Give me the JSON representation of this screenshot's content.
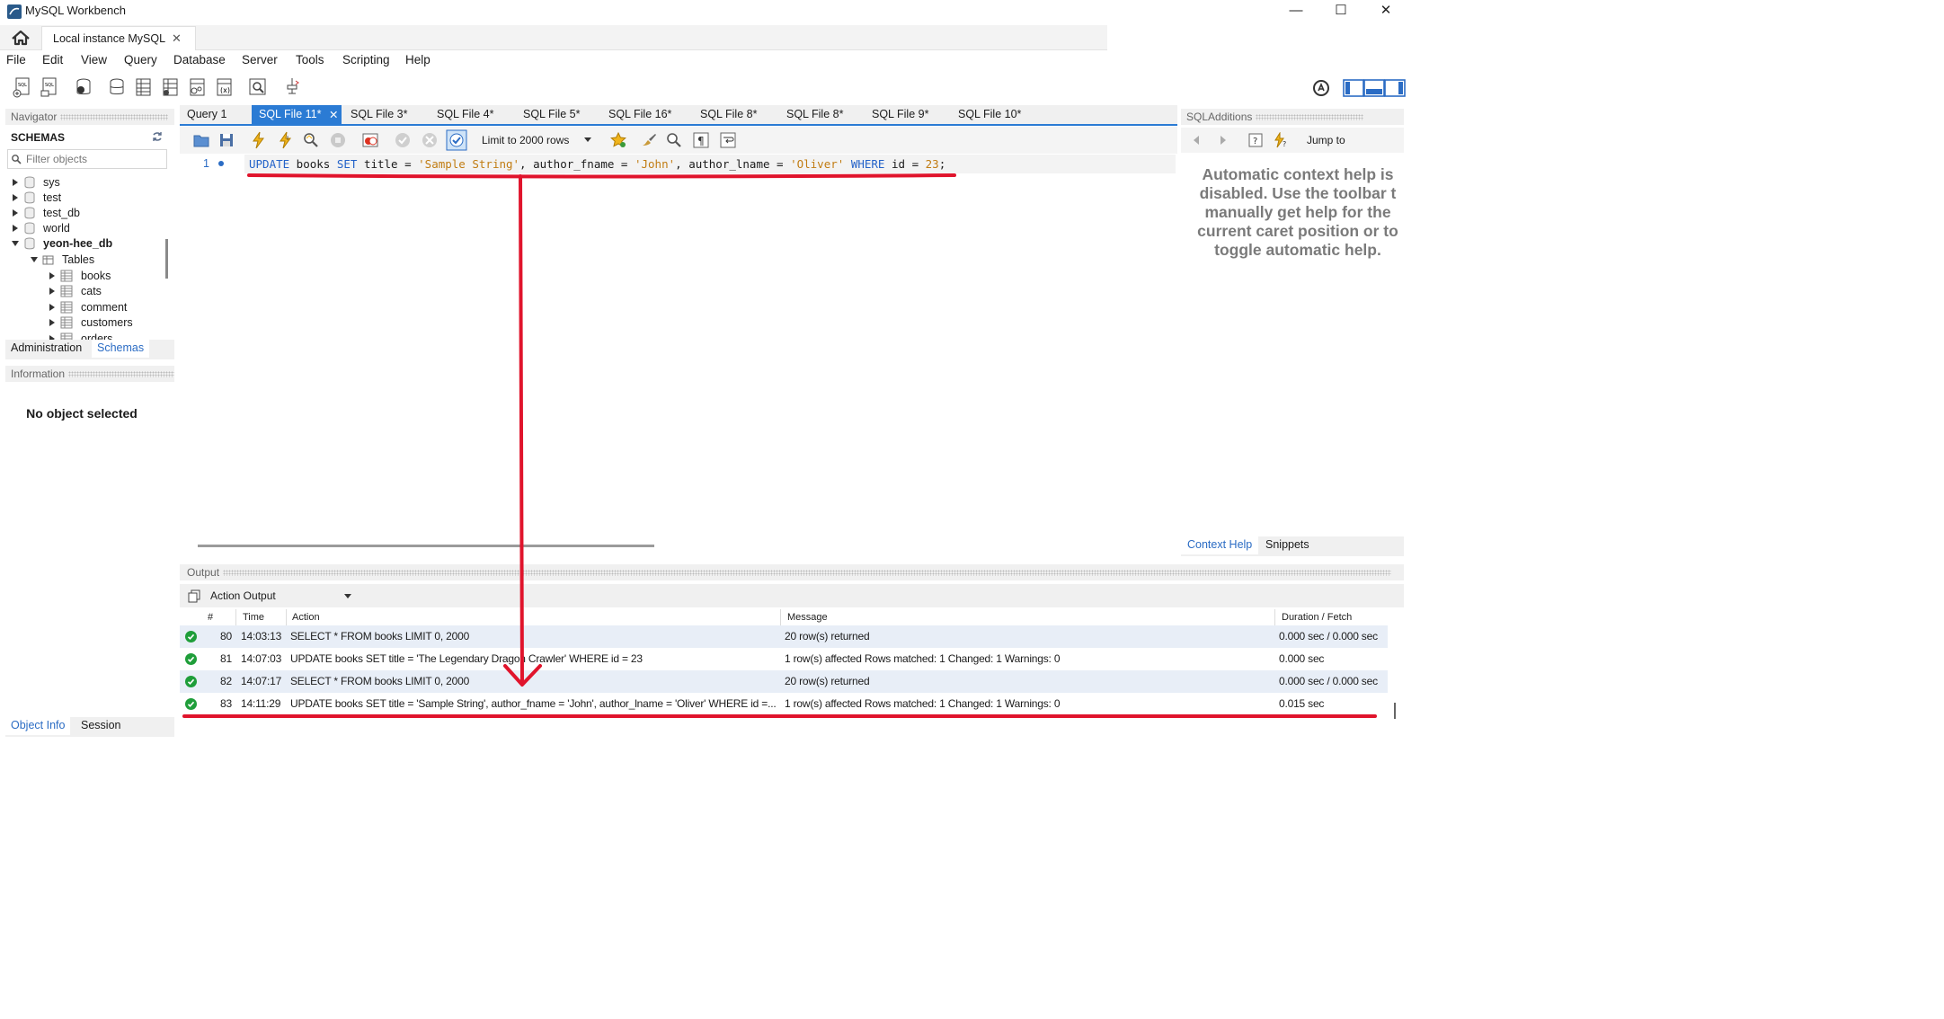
{
  "window": {
    "title": "MySQL Workbench",
    "minimize": "—",
    "maximize": "☐",
    "close": "✕"
  },
  "connection_tab": {
    "label": "Local instance MySQL",
    "close": "✕"
  },
  "menu": [
    "File",
    "Edit",
    "View",
    "Query",
    "Database",
    "Server",
    "Tools",
    "Scripting",
    "Help"
  ],
  "navigator": {
    "header": "Navigator",
    "schemas_title": "SCHEMAS",
    "filter_placeholder": "Filter objects",
    "schemas": [
      "sys",
      "test",
      "test_db",
      "world",
      "yeon-hee_db"
    ],
    "tables_label": "Tables",
    "tables": [
      "books",
      "cats",
      "comment",
      "customers",
      "orders"
    ],
    "tabs": [
      "Administration",
      "Schemas"
    ],
    "information_header": "Information",
    "no_object": "No object selected",
    "bottom_tabs": [
      "Object Info",
      "Session"
    ]
  },
  "editor": {
    "tabs": [
      "Query 1",
      "SQL File 11*",
      "SQL File 3*",
      "SQL File 4*",
      "SQL File 5*",
      "SQL File 16*",
      "SQL File 8*",
      "SQL File 8*",
      "SQL File 9*",
      "SQL File 10*"
    ],
    "active_tab": "SQL File 11*",
    "limit_label": "Limit to 2000 rows",
    "line_number": "1",
    "sql": {
      "kw_update": "UPDATE",
      "t1": " books ",
      "kw_set": "SET",
      "t2": " title = ",
      "s1": "'Sample String'",
      "t3": ", author_fname = ",
      "s2": "'John'",
      "t4": ", author_lname = ",
      "s3": "'Oliver'",
      "t5": " ",
      "kw_where": "WHERE",
      "t6": " id = ",
      "n1": "23",
      "t7": ";"
    }
  },
  "sql_additions": {
    "header": "SQLAdditions",
    "jump_to": "Jump to",
    "help_text": "Automatic context help is\ndisabled. Use the toolbar t\nmanually get help for the\ncurrent caret position or to\ntoggle automatic help.",
    "tabs": [
      "Context Help",
      "Snippets"
    ]
  },
  "output": {
    "header": "Output",
    "selector": "Action Output",
    "columns": [
      "#",
      "Time",
      "Action",
      "Message",
      "Duration / Fetch"
    ],
    "rows": [
      {
        "n": "80",
        "time": "14:03:13",
        "action": "SELECT * FROM books LIMIT 0, 2000",
        "message": "20 row(s) returned",
        "duration": "0.000 sec / 0.000 sec",
        "status": "ok"
      },
      {
        "n": "81",
        "time": "14:07:03",
        "action": "UPDATE books SET title = 'The Legendary Dragon Crawler' WHERE id = 23",
        "message": "1 row(s) affected Rows matched: 1  Changed: 1  Warnings: 0",
        "duration": "0.000 sec",
        "status": "ok"
      },
      {
        "n": "82",
        "time": "14:07:17",
        "action": "SELECT * FROM books LIMIT 0, 2000",
        "message": "20 row(s) returned",
        "duration": "0.000 sec / 0.000 sec",
        "status": "ok"
      },
      {
        "n": "83",
        "time": "14:11:29",
        "action": "UPDATE books SET title = 'Sample String', author_fname = 'John', author_lname = 'Oliver' WHERE id =...",
        "message": "1 row(s) affected Rows matched: 1  Changed: 1  Warnings: 0",
        "duration": "0.015 sec",
        "status": "ok"
      }
    ]
  },
  "colors": {
    "accent": "#2b7bd4",
    "annotation": "#e0142c",
    "ok": "#1f9e3a"
  }
}
